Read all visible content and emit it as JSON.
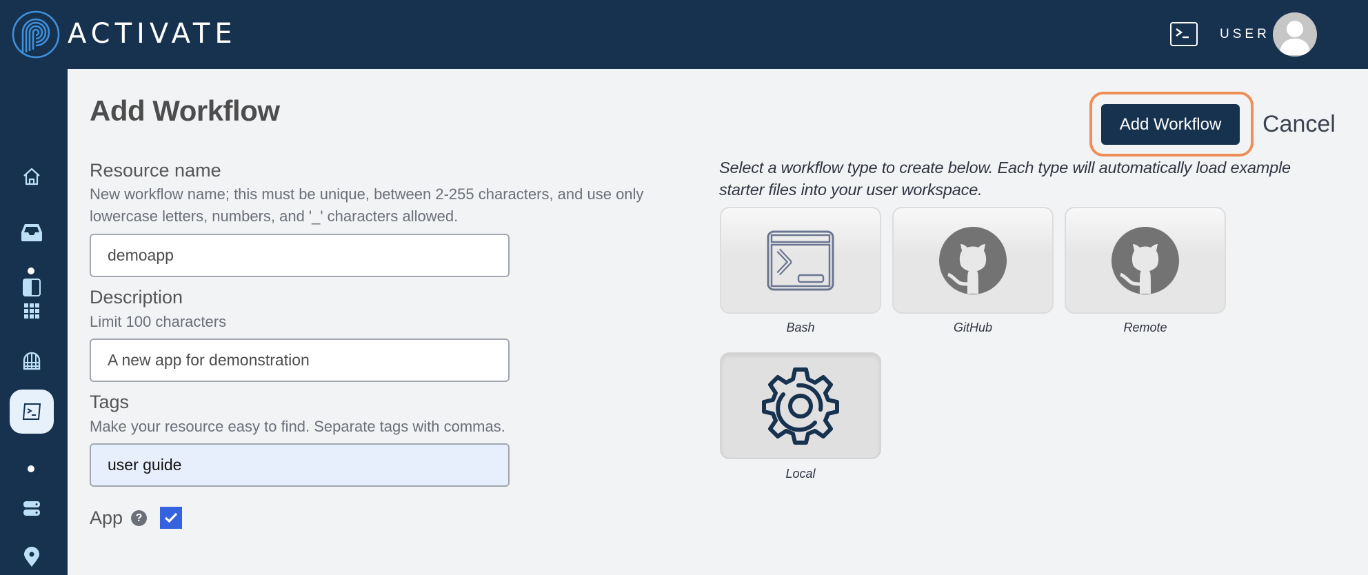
{
  "header": {
    "brand": "ACTIVATE",
    "user_label": "USER",
    "icons": {
      "logo": "activate-logo",
      "terminal": "terminal-icon",
      "avatar": "user-avatar"
    }
  },
  "sidebar": {
    "items": [
      {
        "name": "home",
        "icon": "home-icon",
        "active": false
      },
      {
        "name": "inbox",
        "icon": "inbox-icon",
        "active": false
      },
      {
        "name": "panel",
        "icon": "sidebar-panel-icon",
        "active": false
      },
      {
        "name": "apps",
        "icon": "grid-icon",
        "active": false
      },
      {
        "name": "globe",
        "icon": "globe-icon",
        "active": false
      },
      {
        "name": "workflows",
        "icon": "terminal-icon",
        "active": true
      },
      {
        "name": "storage",
        "icon": "server-icon",
        "active": false
      },
      {
        "name": "locations",
        "icon": "map-pin-icon",
        "active": false
      }
    ]
  },
  "page": {
    "title": "Add Workflow",
    "add_button": "Add Workflow",
    "cancel": "Cancel",
    "accent": "#17324f",
    "focus_ring": "#ef8e55"
  },
  "form": {
    "resource_name": {
      "label": "Resource name",
      "help": "New workflow name; this must be unique, between 2-255 characters, and use only lowercase letters, numbers, and '_' characters allowed.",
      "value": "demoapp"
    },
    "description": {
      "label": "Description",
      "help": "Limit 100 characters",
      "value": "A new app for demonstration"
    },
    "tags": {
      "label": "Tags",
      "help": "Make your resource easy to find. Separate tags with commas.",
      "value": "user guide"
    },
    "app": {
      "label": "App",
      "help_icon": "?",
      "checked": true
    }
  },
  "workflow_types": {
    "help": "Select a workflow type to create below. Each type will automatically load example starter files into your user workspace.",
    "items": [
      {
        "label": "Bash",
        "icon": "bash-terminal-icon",
        "selected": false
      },
      {
        "label": "GitHub",
        "icon": "github-icon",
        "selected": false
      },
      {
        "label": "Remote",
        "icon": "github-icon",
        "selected": false
      },
      {
        "label": "Local",
        "icon": "gear-icon",
        "selected": true
      }
    ]
  }
}
